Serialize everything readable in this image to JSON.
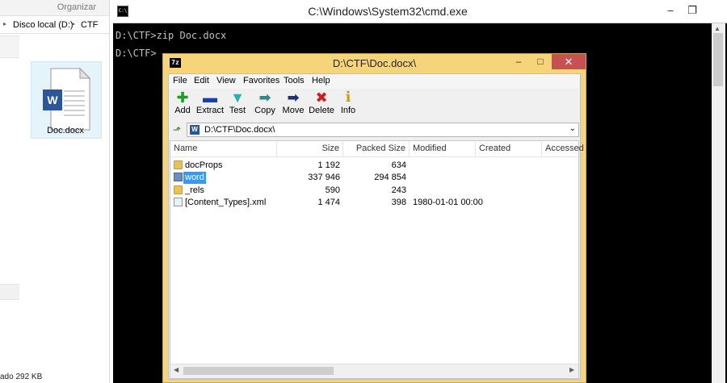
{
  "explorer": {
    "organize_label": "Organizar",
    "breadcrumb": [
      "Disco local (D:)",
      "CTF"
    ],
    "file_name": "Doc.docx",
    "status_text": "ado  292 KB"
  },
  "cmd": {
    "title": "C:\\Windows\\System32\\cmd.exe",
    "icon_text": "C:\\",
    "lines": [
      "D:\\CTF>zip Doc.docx",
      "",
      "D:\\CTF>"
    ]
  },
  "zip": {
    "title": "D:\\CTF\\Doc.docx\\",
    "icon_text": "7z",
    "menu": [
      "File",
      "Edit",
      "View",
      "Favorites",
      "Tools",
      "Help"
    ],
    "tools": [
      {
        "label": "Add",
        "icon": "plus-icon",
        "glyph": "✚",
        "color": "#1e9e1e"
      },
      {
        "label": "Extract",
        "icon": "minus-icon",
        "glyph": "▬",
        "color": "#1b3fa8"
      },
      {
        "label": "Test",
        "icon": "test-check-icon",
        "glyph": "▼",
        "color": "#27b0b0"
      },
      {
        "label": "Copy",
        "icon": "copy-arrows-icon",
        "glyph": "➡",
        "color": "#2b8a8a"
      },
      {
        "label": "Move",
        "icon": "move-arrow-icon",
        "glyph": "➡",
        "color": "#1b2f7a"
      },
      {
        "label": "Delete",
        "icon": "delete-x-icon",
        "glyph": "✖",
        "color": "#d11a1a"
      },
      {
        "label": "Info",
        "icon": "info-icon",
        "glyph": "i",
        "color": "#c9a100"
      }
    ],
    "address": "D:\\CTF\\Doc.docx\\",
    "doc_icon_text": "W",
    "columns": [
      "Name",
      "Size",
      "Packed Size",
      "Modified",
      "Created",
      "Accessed"
    ],
    "rows": [
      {
        "name": "docProps",
        "type": "folder",
        "size": "1 192",
        "packed": "634",
        "modified": ""
      },
      {
        "name": "word",
        "type": "folder-selected",
        "size": "337 946",
        "packed": "294 854",
        "modified": ""
      },
      {
        "name": "_rels",
        "type": "folder",
        "size": "590",
        "packed": "243",
        "modified": ""
      },
      {
        "name": "[Content_Types].xml",
        "type": "file",
        "size": "1 474",
        "packed": "398",
        "modified": "1980-01-01 00:00"
      }
    ]
  },
  "colors": {
    "zip_frame": "#f6d57a",
    "selection": "#3399ff",
    "cmd_bg": "#000000",
    "close_button": "#c75050"
  }
}
